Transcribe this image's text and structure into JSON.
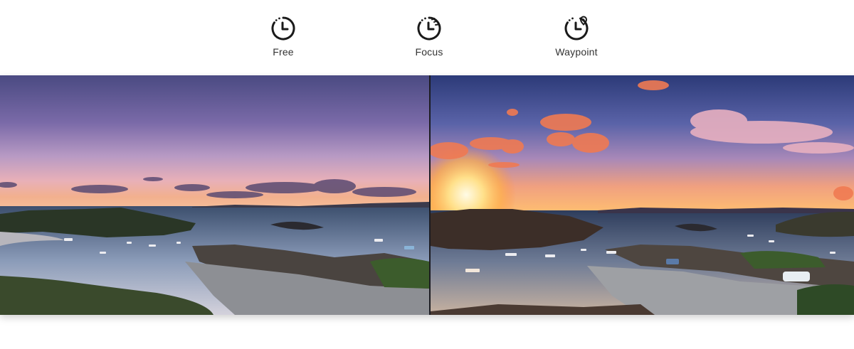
{
  "modes": [
    {
      "label": "Free",
      "icon": "timer-icon"
    },
    {
      "label": "Focus",
      "icon": "timer-focus-icon"
    },
    {
      "label": "Waypoint",
      "icon": "timer-waypoint-icon"
    }
  ],
  "comparison": {
    "left_image": "coastal-bay-dusk-photo",
    "right_image": "coastal-bay-sunset-photo"
  },
  "colors": {
    "icon": "#1a1a1a",
    "label": "#333333"
  }
}
